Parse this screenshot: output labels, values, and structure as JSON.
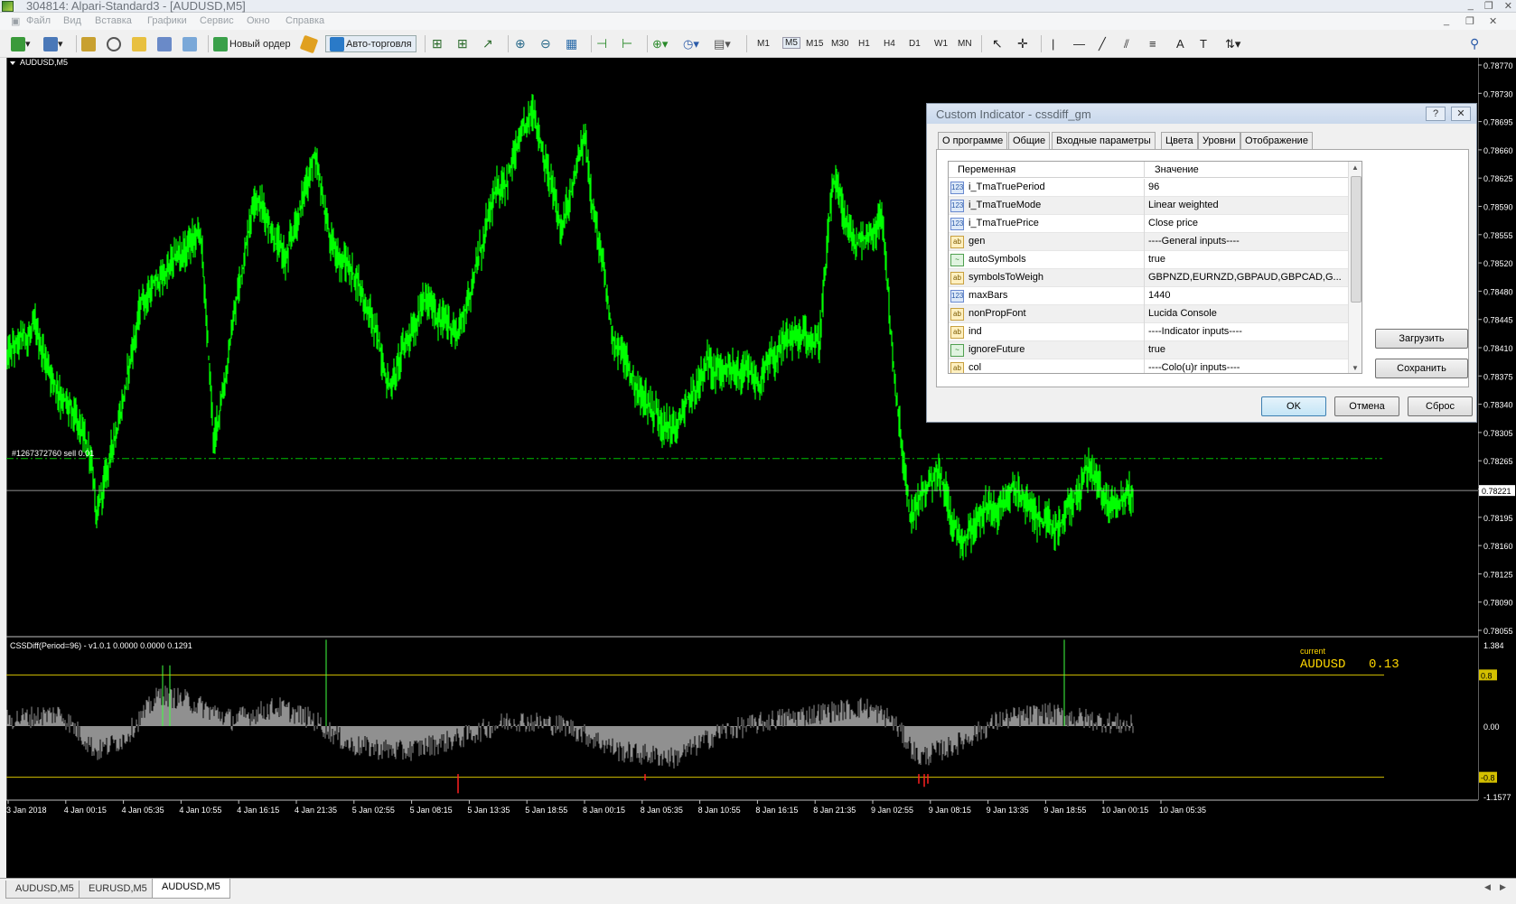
{
  "window": {
    "title": "304814: Alpari-Standard3 - [AUDUSD,M5]"
  },
  "menu": [
    "Файл",
    "Вид",
    "Вставка",
    "Графики",
    "Сервис",
    "Окно",
    "Справка"
  ],
  "toolbar": {
    "new_order": "Новый ордер",
    "auto_trading": "Авто-торговля",
    "timeframes": [
      "M1",
      "M5",
      "M15",
      "M30",
      "H1",
      "H4",
      "D1",
      "W1",
      "MN"
    ],
    "icons": [
      "new-chart-icon",
      "profiles-icon",
      "market-watch-icon",
      "navigator-icon",
      "data-window-icon",
      "terminal-icon",
      "strategy-tester-icon",
      "new-order-icon",
      "metaeditor-icon",
      "auto-trading-icon",
      "bar-chart-icon",
      "candlestick-icon",
      "line-chart-icon",
      "zoom-in-icon",
      "zoom-out-icon",
      "tile-windows-icon",
      "chart-shift-icon",
      "autoscroll-icon",
      "indicators-icon",
      "periods-icon",
      "templates-icon",
      "cursor-icon",
      "crosshair-icon",
      "vertical-line-icon",
      "horizontal-line-icon",
      "trendline-icon",
      "equidistant-channel-icon",
      "fibonacci-icon",
      "text-icon",
      "text-label-icon",
      "arrows-icon",
      "search-icon"
    ]
  },
  "chart": {
    "symbol_label": "AUDUSD,M5",
    "order_label": "#1267372760 sell 0.01",
    "current_price": "0.78221",
    "price_ticks": [
      "0.78770",
      "0.78730",
      "0.78695",
      "0.78660",
      "0.78625",
      "0.78590",
      "0.78555",
      "0.78520",
      "0.78480",
      "0.78445",
      "0.78410",
      "0.78375",
      "0.78340",
      "0.78305",
      "0.78265",
      "0.78230",
      "0.78195",
      "0.78160",
      "0.78125",
      "0.78090",
      "0.78055"
    ],
    "time_ticks": [
      "3 Jan 2018",
      "4 Jan 00:15",
      "4 Jan 05:35",
      "4 Jan 10:55",
      "4 Jan 16:15",
      "4 Jan 21:35",
      "5 Jan 02:55",
      "5 Jan 08:15",
      "5 Jan 13:35",
      "5 Jan 18:55",
      "8 Jan 00:15",
      "8 Jan 05:35",
      "8 Jan 10:55",
      "8 Jan 16:15",
      "8 Jan 21:35",
      "9 Jan 02:55",
      "9 Jan 08:15",
      "9 Jan 13:35",
      "9 Jan 18:55",
      "10 Jan 00:15",
      "10 Jan 05:35"
    ],
    "price_range": [
      0.7803,
      0.7879
    ],
    "order_price": 0.78263,
    "current_price_value": 0.78221,
    "colors": {
      "bars": "#00ff00",
      "order_line": "#00c000",
      "bid_line": "#c0c0c0",
      "levels": "#d4c000",
      "histogram": "#909090",
      "current_text": "#ffd700",
      "down_spikes": "#ff2020"
    }
  },
  "indicator": {
    "label": "CSSDiff(Period=96) - v1.0.1 0.0000 0.0000 0.1291",
    "current_label": "current",
    "current_symbol": "AUDUSD",
    "current_value": "0.13",
    "axis": [
      "1.384",
      "0.8",
      "0.00",
      "-0.8",
      "-1.1577"
    ],
    "range": [
      -1.1577,
      1.384
    ],
    "levels": [
      0.8,
      -0.8
    ]
  },
  "tabs": [
    "AUDUSD,M5",
    "EURUSD,M5",
    "AUDUSD,M5"
  ],
  "active_tab": 2,
  "dialog": {
    "title": "Custom Indicator - cssdiff_gm",
    "help": "?",
    "close": "✕",
    "tabs": [
      "О программе",
      "Общие",
      "Входные параметры",
      "Цвета",
      "Уровни",
      "Отображение"
    ],
    "active_tab": 2,
    "columns": [
      "Переменная",
      "Значение"
    ],
    "rows": [
      {
        "type": "123",
        "name": "i_TmaTruePeriod",
        "value": "96"
      },
      {
        "type": "123",
        "name": "i_TmaTrueMode",
        "value": "Linear weighted"
      },
      {
        "type": "123",
        "name": "i_TmaTruePrice",
        "value": "Close price"
      },
      {
        "type": "ab",
        "name": "gen",
        "value": "----General inputs----"
      },
      {
        "type": "bool",
        "name": "autoSymbols",
        "value": "true"
      },
      {
        "type": "ab",
        "name": "symbolsToWeigh",
        "value": "GBPNZD,EURNZD,GBPAUD,GBPCAD,G..."
      },
      {
        "type": "123",
        "name": "maxBars",
        "value": "1440"
      },
      {
        "type": "ab",
        "name": "nonPropFont",
        "value": "Lucida Console"
      },
      {
        "type": "ab",
        "name": "ind",
        "value": "----Indicator inputs----"
      },
      {
        "type": "bool",
        "name": "ignoreFuture",
        "value": "true"
      },
      {
        "type": "ab",
        "name": "col",
        "value": "----Colo(u)r inputs----"
      }
    ],
    "load": "Загрузить",
    "save": "Сохранить",
    "ok": "OK",
    "cancel": "Отмена",
    "reset": "Сброс"
  }
}
